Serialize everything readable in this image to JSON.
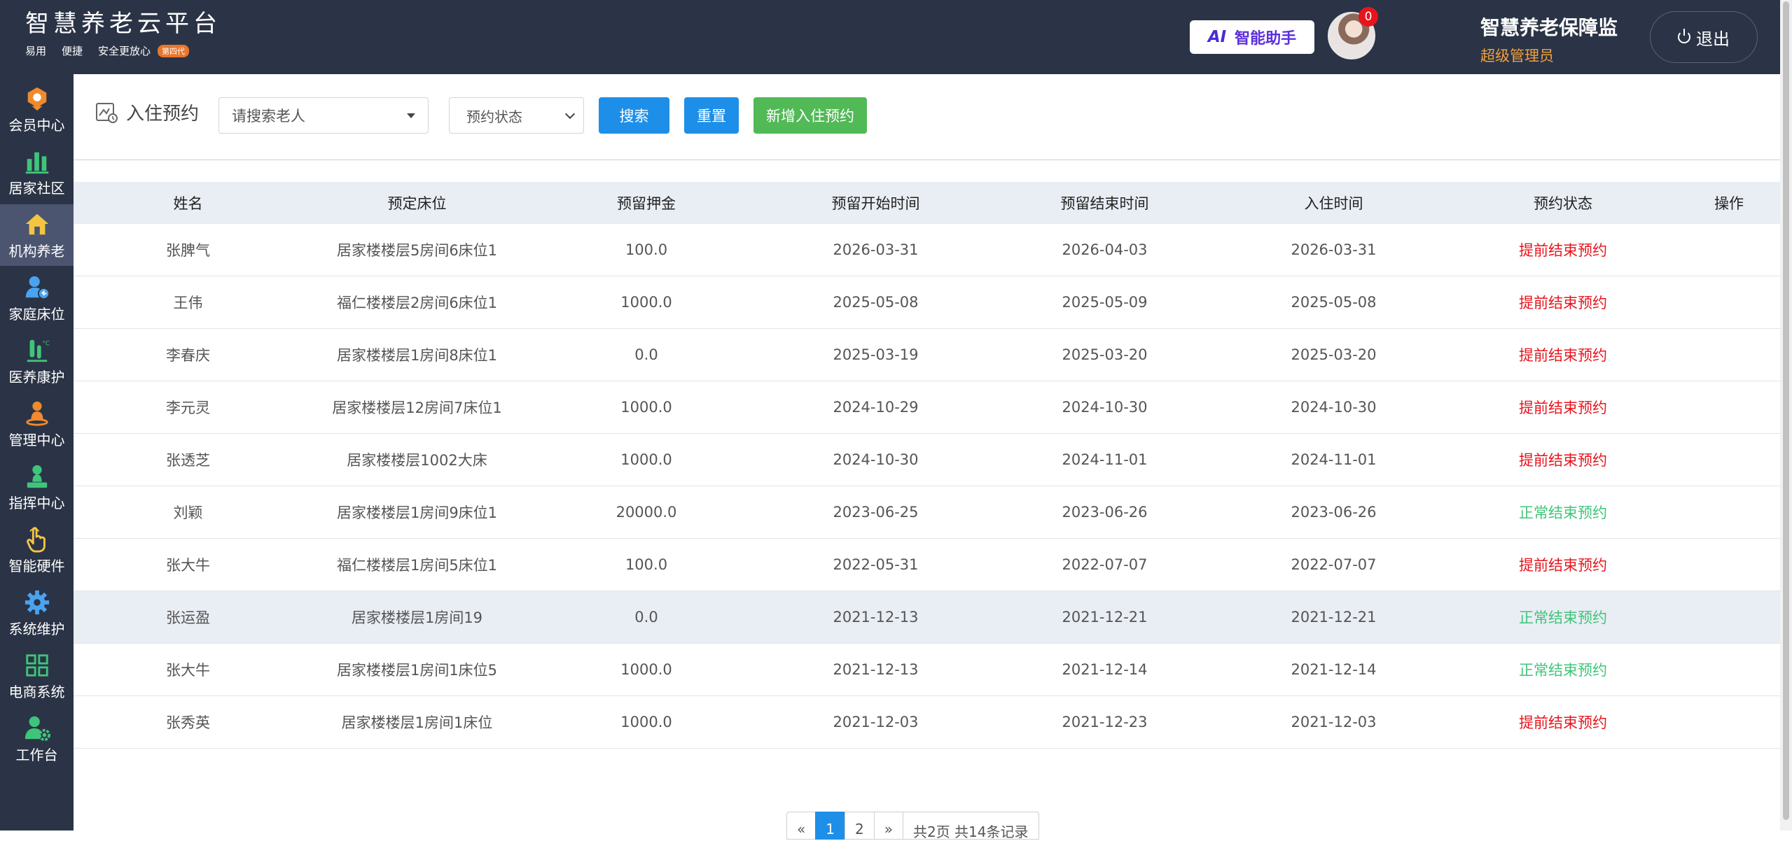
{
  "brand": {
    "title": "智慧养老云平台",
    "tags": [
      "易用",
      "便捷",
      "安全更放心"
    ],
    "badge": "第四代"
  },
  "header": {
    "ai_mark": "AI",
    "ai_label": "智能助手",
    "notification_count": "0",
    "org_name": "智慧养老保障监",
    "role": "超级管理员",
    "logout_label": "退出"
  },
  "sidebar": {
    "items": [
      {
        "label": "会员中心",
        "icon": "member-badge-icon",
        "color": "#f08a2c"
      },
      {
        "label": "居家社区",
        "icon": "bar-chart-icon",
        "color": "#3fc57a"
      },
      {
        "label": "机构养老",
        "icon": "home-icon",
        "color": "#f5c542"
      },
      {
        "label": "家庭床位",
        "icon": "user-bed-icon",
        "color": "#4aa3f0"
      },
      {
        "label": "医养康护",
        "icon": "test-tube-icon",
        "color": "#3fc57a"
      },
      {
        "label": "管理中心",
        "icon": "person-manager-icon",
        "color": "#f08a2c"
      },
      {
        "label": "指挥中心",
        "icon": "command-stamp-icon",
        "color": "#3fc57a"
      },
      {
        "label": "智能硬件",
        "icon": "touch-hand-icon",
        "color": "#f5c542"
      },
      {
        "label": "系统维护",
        "icon": "gear-icon",
        "color": "#4aa3f0"
      },
      {
        "label": "电商系统",
        "icon": "grid-apps-icon",
        "color": "#3fc57a"
      },
      {
        "label": "工作台",
        "icon": "user-gear-icon",
        "color": "#3fc57a"
      }
    ],
    "active_index": 2
  },
  "toolbar": {
    "page_title": "入住预约",
    "search_placeholder": "请搜索老人",
    "status_placeholder": "预约状态",
    "search_label": "搜索",
    "reset_label": "重置",
    "add_label": "新增入住预约"
  },
  "table": {
    "columns": [
      "姓名",
      "预定床位",
      "预留押金",
      "预留开始时间",
      "预留结束时间",
      "入住时间",
      "预约状态",
      "操作"
    ],
    "rows": [
      {
        "name": "张脾气",
        "bed": "居家楼楼层5房间6床位1",
        "deposit": "100.0",
        "start": "2026-03-31",
        "end": "2026-04-03",
        "checkin": "2026-03-31",
        "status": "提前结束预约",
        "status_type": "early"
      },
      {
        "name": "王伟",
        "bed": "福仁楼楼层2房间6床位1",
        "deposit": "1000.0",
        "start": "2025-05-08",
        "end": "2025-05-09",
        "checkin": "2025-05-08",
        "status": "提前结束预约",
        "status_type": "early"
      },
      {
        "name": "李春庆",
        "bed": "居家楼楼层1房间8床位1",
        "deposit": "0.0",
        "start": "2025-03-19",
        "end": "2025-03-20",
        "checkin": "2025-03-20",
        "status": "提前结束预约",
        "status_type": "early"
      },
      {
        "name": "李元灵",
        "bed": "居家楼楼层12房间7床位1",
        "deposit": "1000.0",
        "start": "2024-10-29",
        "end": "2024-10-30",
        "checkin": "2024-10-30",
        "status": "提前结束预约",
        "status_type": "early"
      },
      {
        "name": "张透芝",
        "bed": "居家楼楼层1002大床",
        "deposit": "1000.0",
        "start": "2024-10-30",
        "end": "2024-11-01",
        "checkin": "2024-11-01",
        "status": "提前结束预约",
        "status_type": "early"
      },
      {
        "name": "刘颖",
        "bed": "居家楼楼层1房间9床位1",
        "deposit": "20000.0",
        "start": "2023-06-25",
        "end": "2023-06-26",
        "checkin": "2023-06-26",
        "status": "正常结束预约",
        "status_type": "normal"
      },
      {
        "name": "张大牛",
        "bed": "福仁楼楼层1房间5床位1",
        "deposit": "100.0",
        "start": "2022-05-31",
        "end": "2022-07-07",
        "checkin": "2022-07-07",
        "status": "提前结束预约",
        "status_type": "early"
      },
      {
        "name": "张运盈",
        "bed": "居家楼楼层1房间19",
        "deposit": "0.0",
        "start": "2021-12-13",
        "end": "2021-12-21",
        "checkin": "2021-12-21",
        "status": "正常结束预约",
        "status_type": "normal"
      },
      {
        "name": "张大牛",
        "bed": "居家楼楼层1房间1床位5",
        "deposit": "1000.0",
        "start": "2021-12-13",
        "end": "2021-12-14",
        "checkin": "2021-12-14",
        "status": "正常结束预约",
        "status_type": "normal"
      },
      {
        "name": "张秀英",
        "bed": "居家楼楼层1房间1床位",
        "deposit": "1000.0",
        "start": "2021-12-03",
        "end": "2021-12-23",
        "checkin": "2021-12-03",
        "status": "提前结束预约",
        "status_type": "early"
      }
    ],
    "highlighted_row": 7
  },
  "pagination": {
    "prev": "«",
    "pages": [
      "1",
      "2"
    ],
    "current": "1",
    "next": "»",
    "summary": "共2页 共14条记录"
  },
  "colors": {
    "topbar_bg": "#2b3446",
    "primary": "#1e8fe8",
    "success": "#52b957",
    "status_early": "#e8141c",
    "status_normal": "#3fc57a",
    "role_text": "#f2a03c"
  }
}
